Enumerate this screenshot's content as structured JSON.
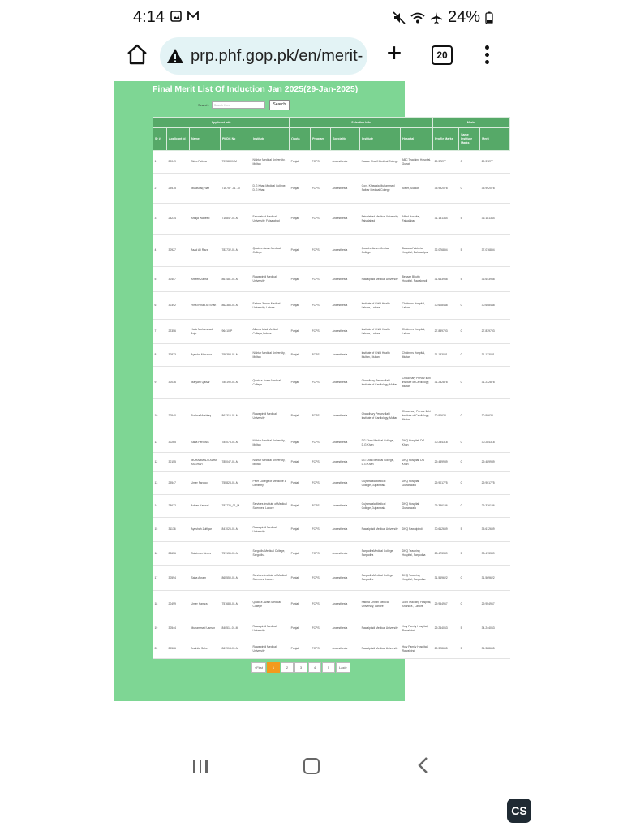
{
  "status_bar": {
    "time": "4:14",
    "battery": "24%"
  },
  "browser": {
    "url": "prp.phf.gop.pk/en/merit-",
    "tab_count": "20"
  },
  "page": {
    "title": "Final Merit List Of Induction Jan 2025(29-Jan-2025)",
    "search_label": "Search:",
    "search_placeholder": "Search Here",
    "search_button": "Search"
  },
  "table": {
    "group_headers": [
      "Applicant Info",
      "Selection Info",
      "Marks"
    ],
    "columns": [
      "Sr #",
      "Applicant Id",
      "Name",
      "PMDC No",
      "Institute",
      "Quota",
      "Program",
      "Speciality",
      "Institute",
      "Hospital",
      "Profile Marks",
      "Same Institute Marks",
      "Merit"
    ],
    "rows": [
      [
        "1",
        "20049",
        "Sidra Fatima",
        "79958-01-M",
        "Nishtar Medical University, Multan",
        "Punjab",
        "FCPS",
        "Anaesthesia",
        "Nawaz Sharif Medical College",
        "ABC Teaching Hospital, Gujrat",
        "29.37277",
        "0",
        "29.37277"
      ],
      [
        "2",
        "29575",
        "Mutasdaq Riaz",
        "716757 -01 -M",
        "D.G Khan Medical College, D.G Khan",
        "Punjab",
        "FCPS",
        "Anaesthesia",
        "Govt. Khawaja Muhammad Safdar Medical College",
        "AIMH, Sialkot",
        "35.992078",
        "0",
        "35.992078"
      ],
      [
        "3",
        "23234",
        "Ahnija Waheed",
        "716847-01-M",
        "Faisalabad Medical University, Faisalabad",
        "Punjab",
        "FCPS",
        "Anaesthesia",
        "Faisalabad Medical University, Faisalabad",
        "Allied Hospital, Faisalabad",
        "31.181364",
        "5",
        "36.181364"
      ],
      [
        "4",
        "30927",
        "Asad Ali Raza",
        "783732-01-M",
        "Quaid-e-Azam Medical College",
        "Punjab",
        "FCPS",
        "Anaesthesia",
        "Quaid-e-Azam Medical College",
        "Bahawal Victoria Hospital, Bahawalpur",
        "32.076894",
        "5",
        "37.076894"
      ],
      [
        "5",
        "30457",
        "Arifeen Zahra",
        "861481-01-M",
        "Rawalpindi Medical University",
        "Punjab",
        "FCPS",
        "Anaesthesia",
        "Rawalpindi Medical University",
        "Benazir Bhutto Hospital, Rawalpindi",
        "31.643958",
        "5",
        "36.643958"
      ],
      [
        "6",
        "30392",
        "Hina Irshad Ali Shah",
        "862386-01-M",
        "Fatima Jinnah Medical University, Lahore",
        "Punjab",
        "FCPS",
        "Anaesthesia",
        "Institute of Child Health Lahore, Lahore",
        "Childrens Hospital, Lahore",
        "30.608448",
        "0",
        "30.608448"
      ],
      [
        "7",
        "22356",
        "Hafiz Muhammad Aqib",
        "96410-P",
        "Allama Iqbal Medical College,Lahore",
        "Punjab",
        "FCPS",
        "Anaesthesia",
        "Institute of Child Health Lahore, Lahore",
        "Childrens Hospital, Lahore",
        "27.839793",
        "0",
        "27.839793"
      ],
      [
        "8",
        "30823",
        "Ayesha Manzoor",
        "799393-01-M",
        "Nishtar Medical University, Multan",
        "Punjab",
        "FCPS",
        "Anaesthesia",
        "Institute of Child Health Multan, Multan",
        "Childrens Hospital, Multan",
        "31.133031",
        "0",
        "31.133031"
      ],
      [
        "9",
        "30036",
        "Maryam Qaisar",
        "785190-01-M",
        "Quaid-e-Azam Medical College",
        "Punjab",
        "FCPS",
        "Anaesthesia",
        "Chaudhary Pervez Ilahi Institute of Cardiology, Multan",
        "Chaudhary Pervez Ilahi Institute of Cardiology, Multan",
        "31.232878",
        "0",
        "31.232878"
      ],
      [
        "10",
        "20540",
        "Bushra Mushtaq",
        "861316-01-M",
        "Rawalpindi Medical University",
        "Punjab",
        "FCPS",
        "Anaesthesia",
        "Chaudhary Pervez Ilahi Institute of Cardiology, Multan",
        "Chaudhary Pervez Ilahi Institute of Cardiology, Multan",
        "30.90638",
        "0",
        "30.90638"
      ],
      [
        "11",
        "30265",
        "Saba Perdosis",
        "784073-01-M",
        "Nishtar Medical University, Multan",
        "Punjab",
        "FCPS",
        "Anaesthesia",
        "DG Khan Medical College, D.G Khan",
        "DHQ Hospital, DG Khan",
        "30.284318",
        "0",
        "30.284318"
      ],
      [
        "12",
        "30155",
        "MUHAMMAD TALHA ASGHAR",
        "785047-01-M",
        "Nishtar Medical University, Multan",
        "Punjab",
        "FCPS",
        "Anaesthesia",
        "DG Khan Medical College, D.G Khan",
        "DHQ Hospital, DG Khan",
        "29.489989",
        "0",
        "29.489989"
      ],
      [
        "13",
        "29547",
        "Umer Farooq",
        "755823-01-M",
        "PMH College of Medicine & Dentistry",
        "Punjab",
        "FCPS",
        "Anaesthesia",
        "Gujranwala Medical College,Gujranwala",
        "DHQ Hospital, Gujranwala",
        "29.901775",
        "0",
        "29.901775"
      ],
      [
        "14",
        "28622",
        "Adnan Kanwal",
        "782725_01_M",
        "Services Institute of Medical Sciences, Lahore",
        "Punjab",
        "FCPS",
        "Anaesthesia",
        "Gujranwala Medical College,Gujranwala",
        "DHQ Hospital, Gujranwala",
        "29.336136",
        "0",
        "29.336136"
      ],
      [
        "15",
        "31176",
        "Ayeshah Zulfiqar",
        "841026-01-M",
        "Rawalpindi Medical University",
        "Punjab",
        "FCPS",
        "Anaesthesia",
        "Rawalpindi Medical University",
        "DHQ Rawalpindi",
        "30.612659",
        "5",
        "35.612659"
      ],
      [
        "16",
        "28656",
        "Sulaiman Idrees",
        "757136-01-M",
        "SargodhaMedical College, Sargodha",
        "Punjab",
        "FCPS",
        "Anaesthesia",
        "SargodhaMedical College, Sargodha",
        "DHQ Teaching Hospital, Sargodha",
        "28.473339",
        "5",
        "33.473339"
      ],
      [
        "17",
        "30594",
        "Saba Akram",
        "865550-01-M",
        "Services Institute of Medical Sciences, Lahore",
        "Punjab",
        "FCPS",
        "Anaesthesia",
        "SargodhaMedical College, Sargodha",
        "DHQ Teaching Hospital, Sargodha",
        "31.569622",
        "0",
        "31.569622"
      ],
      [
        "18",
        "20499",
        "Umer Hamza",
        "757688-01-M",
        "Quaid-e-Azam Medical College",
        "Punjab",
        "FCPS",
        "Anaesthesia",
        "Fatima Jinnah Medical University, Lahore",
        "Govt Teaching Hospital, Shahdra , Lahore",
        "29.954967",
        "0",
        "29.954967"
      ],
      [
        "19",
        "30544",
        "Muhammad Usman",
        "840511-01-M",
        "Rawalpindi Medical University",
        "Punjab",
        "FCPS",
        "Anaesthesia",
        "Rawalpindi Medical University",
        "Holy Family Hospital, Rawalpindi",
        "29.244063",
        "5",
        "34.244063"
      ],
      [
        "20",
        "29566",
        "Anahita Saher",
        "861914-01-M",
        "Rawalpindi Medical University",
        "Punjab",
        "FCPS",
        "Anaesthesia",
        "Rawalpindi Medical University",
        "Holy Family Hospital, Rawalpindi",
        "29.328655",
        "5",
        "34.328655"
      ]
    ]
  },
  "pagination": {
    "first": "«First",
    "pages": [
      "1",
      "2",
      "3",
      "4",
      "5"
    ],
    "active_page": "1",
    "last": "Last»"
  },
  "colors": {
    "page_green": "#7ed694",
    "header_green": "#56a968",
    "active_page": "#f29a1d",
    "url_bar": "#e3f3f5"
  },
  "nav_bar": {
    "recents": "recents-icon",
    "home": "home-icon",
    "back": "back-icon"
  },
  "overlay_badge": "CS"
}
